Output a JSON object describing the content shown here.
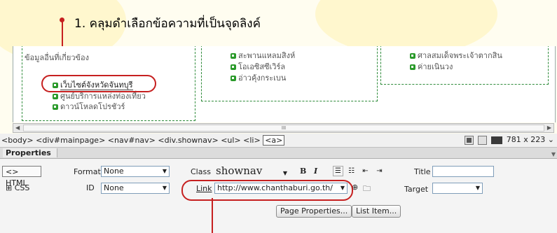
{
  "instruction": "1. คลุมดำเลือกข้อความที่เป็นจุดลิงค์",
  "content": {
    "col1": {
      "heading": "ข้อมูลอื่นที่เกี่ยวข้อง",
      "items": [
        "เว็บไซต์จังหวัดจันทบุรี",
        "ศูนย์บริการแหล่งท่องเที่ยว",
        "ดาวน์โหลดโปรชัวร์"
      ]
    },
    "col2": {
      "items": [
        "สะพานแหลมสิงห์",
        "โอเอซิสซีเวิร์ล",
        "อ่าวคุ้งกระเบน"
      ]
    },
    "col3": {
      "items": [
        "ศาลสมเด็จพระเจ้าตากสิน",
        "ค่ายเนินวง"
      ]
    },
    "scroll_label": "III"
  },
  "status": {
    "tags": [
      "<body>",
      "<div#mainpage>",
      "<nav#nav>",
      "<div.shownav>",
      "<ul>",
      "<li>",
      "<a>"
    ],
    "size": "781 x 223"
  },
  "panel": {
    "title": "Properties",
    "html_btn": "HTML",
    "css_btn": "CSS",
    "format_label": "Format",
    "format_value": "None",
    "id_label": "ID",
    "id_value": "None",
    "class_label": "Class",
    "class_value": "shownav",
    "bold": "B",
    "italic": "I",
    "title_label": "Title",
    "link_label": "Link",
    "link_value": "http://www.chanthaburi.go.th/",
    "target_label": "Target",
    "page_properties": "Page Properties...",
    "list_item": "List Item..."
  },
  "colors": {
    "annotation": "#c62020",
    "bullet": "#2a9a2a",
    "dashed_border": "#2e8b3a"
  }
}
